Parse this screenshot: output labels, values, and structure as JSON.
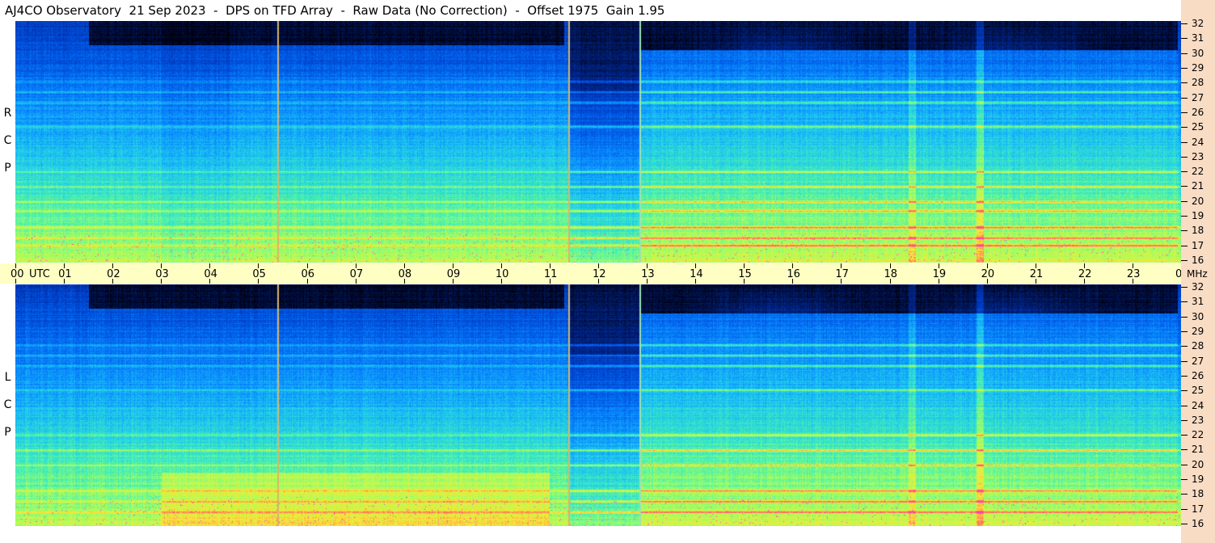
{
  "title": "AJ4CO Observatory  21 Sep 2023  -  DPS on TFD Array  -  Raw Data (No Correction)  -  Offset 1975  Gain 1.95",
  "colors": {
    "background": "#ffffff",
    "time_axis_band": "#ffffc4",
    "freq_axis_band": "#f9dcc4",
    "colormap": [
      "#000010",
      "#001a66",
      "#0033b3",
      "#0059e6",
      "#0a8cff",
      "#1ec8f0",
      "#46f0b4",
      "#aaff5a",
      "#ffe632",
      "#ff6464",
      "#ff3cc8"
    ]
  },
  "x_axis": {
    "unit_label": "UTC",
    "tick_labels": [
      "00",
      "01",
      "02",
      "03",
      "04",
      "05",
      "06",
      "07",
      "08",
      "09",
      "10",
      "11",
      "12",
      "13",
      "14",
      "15",
      "16",
      "17",
      "18",
      "19",
      "20",
      "21",
      "22",
      "23",
      "00"
    ]
  },
  "y_axis": {
    "unit_label": "MHz",
    "tick_labels": [
      "32",
      "31",
      "30",
      "29",
      "28",
      "27",
      "26",
      "25",
      "24",
      "23",
      "22",
      "21",
      "20",
      "19",
      "18",
      "17",
      "16"
    ]
  },
  "chart_data": [
    {
      "type": "heatmap",
      "panel": "top",
      "polarization_letters": [
        "R",
        "C",
        "P"
      ],
      "x_unit": "UTC hours",
      "y_unit": "MHz",
      "xlim": [
        0,
        24
      ],
      "ylim": [
        16,
        32
      ],
      "vertical_event_lines_utc": [
        5.4,
        11.4,
        12.85
      ],
      "persistent_emission_lines_mhz": [
        17.1,
        17.6,
        18.3,
        19.4,
        20.0,
        21.0,
        22.0,
        25.0,
        26.6,
        27.3,
        28.0
      ]
    },
    {
      "type": "heatmap",
      "panel": "bottom",
      "polarization_letters": [
        "L",
        "C",
        "P"
      ],
      "x_unit": "UTC hours",
      "y_unit": "MHz",
      "xlim": [
        0,
        24
      ],
      "ylim": [
        16,
        32
      ],
      "vertical_event_lines_utc": [
        5.4,
        11.4,
        12.85
      ],
      "persistent_emission_lines_mhz": [
        16.9,
        17.6,
        18.3,
        20.0,
        21.0,
        22.0,
        25.0,
        26.6,
        27.3,
        28.0
      ]
    }
  ]
}
